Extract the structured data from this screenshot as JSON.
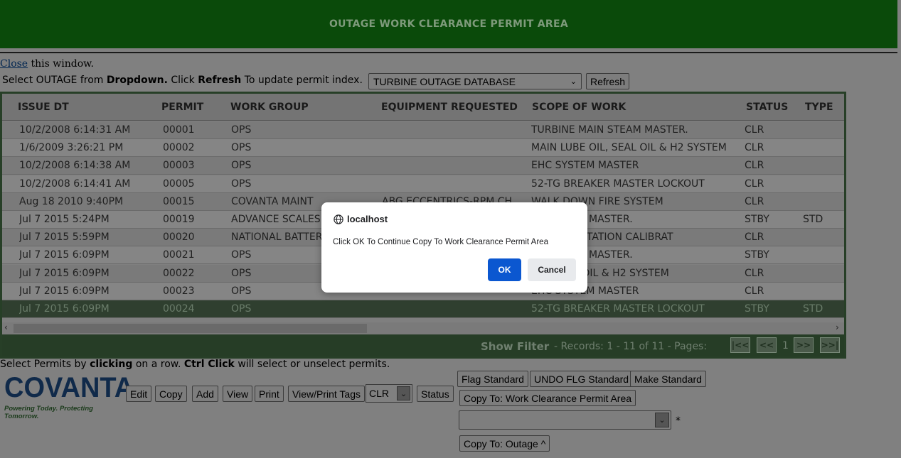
{
  "header": {
    "title": "OUTAGE WORK CLEARANCE PERMIT AREA"
  },
  "close_bar": {
    "link": "Close",
    "rest": " this window."
  },
  "select_bar": {
    "t1": "Select OUTAGE from ",
    "b1": "Dropdown.",
    "t2": " Click ",
    "b2": "Refresh",
    "t3": " To update permit index.",
    "outage_value": "TURBINE OUTAGE DATABASE",
    "refresh_label": "Refresh"
  },
  "table": {
    "columns": [
      "ISSUE DT",
      "PERMIT",
      "WORK GROUP",
      "EQUIPMENT REQUESTED",
      "SCOPE OF WORK",
      "STATUS",
      "TYPE"
    ],
    "rows": [
      {
        "issue_dt": "10/2/2008 6:14:31 AM",
        "permit": "00001",
        "work_group": "OPS",
        "equipment": "",
        "scope": "TURBINE MAIN STEAM MASTER.",
        "status": "CLR",
        "type": ""
      },
      {
        "issue_dt": "1/6/2009 3:26:21 PM",
        "permit": "00002",
        "work_group": "OPS",
        "equipment": "",
        "scope": "MAIN LUBE OIL, SEAL OIL & H2 SYSTEM",
        "status": "CLR",
        "type": ""
      },
      {
        "issue_dt": "10/2/2008 6:14:38 AM",
        "permit": "00003",
        "work_group": "OPS",
        "equipment": "",
        "scope": "EHC SYSTEM MASTER",
        "status": "CLR",
        "type": ""
      },
      {
        "issue_dt": "10/2/2008 6:14:41 AM",
        "permit": "00005",
        "work_group": "OPS",
        "equipment": "",
        "scope": "52-TG BREAKER MASTER LOCKOUT",
        "status": "CLR",
        "type": ""
      },
      {
        "issue_dt": "Aug 18 2010 9:40PM",
        "permit": "00015",
        "work_group": "COVANTA MAINT",
        "equipment": "ABG ECCENTRICS-RPM CH",
        "scope": "WALK DOWN FIRE SYSTEM",
        "status": "CLR",
        "type": ""
      },
      {
        "issue_dt": "Jul 7 2015 5:24PM",
        "permit": "00019",
        "work_group": "ADVANCE SCALES",
        "equipment": "",
        "scope": "AIN STEAM MASTER.",
        "status": "STBY",
        "type": "STD"
      },
      {
        "issue_dt": "Jul 7 2015 5:59PM",
        "permit": "00020",
        "work_group": "NATIONAL BATTERY",
        "equipment": "",
        "scope": "NSTERMENTATION CALIBRAT",
        "status": "CLR",
        "type": ""
      },
      {
        "issue_dt": "Jul 7 2015 6:09PM",
        "permit": "00021",
        "work_group": "OPS",
        "equipment": "",
        "scope": "AIN STEAM MASTER.",
        "status": "STBY",
        "type": ""
      },
      {
        "issue_dt": "Jul 7 2015 6:09PM",
        "permit": "00022",
        "work_group": "OPS",
        "equipment": "",
        "scope": "OIL, SEAL OIL & H2 SYSTEM",
        "status": "CLR",
        "type": ""
      },
      {
        "issue_dt": "Jul 7 2015 6:09PM",
        "permit": "00023",
        "work_group": "OPS",
        "equipment": "",
        "scope": "EHC SYSTEM MASTER",
        "status": "CLR",
        "type": ""
      },
      {
        "issue_dt": "Jul 7 2015 6:09PM",
        "permit": "00024",
        "work_group": "OPS",
        "equipment": "",
        "scope": "52-TG BREAKER MASTER LOCKOUT",
        "status": "STBY",
        "type": "STD"
      }
    ]
  },
  "pager": {
    "show_filter": "Show Filter",
    "records": "-   Records: 1 - 11 of 11 - Pages:",
    "page": "1",
    "first": "|<<",
    "prev": "<<",
    "next": ">>",
    "last": ">>|"
  },
  "hint": {
    "t1": "Select Permits by ",
    "b1": "clicking",
    "t2": " on a row. ",
    "b2": "Ctrl Click",
    "t3": " will select or unselect permits."
  },
  "logo": {
    "name": "COVANTA",
    "tagline": "Powering Today. Protecting Tomorrow."
  },
  "actions": {
    "edit": "Edit",
    "copy": "Copy",
    "add": "Add",
    "view": "View",
    "print": "Print",
    "view_print_tags": "View/Print Tags",
    "status_value": "CLR",
    "status_btn": "Status",
    "flag_standard": "Flag Standard",
    "undo_flg_standard": "UNDO FLG Standard",
    "make_standard": "Make Standard",
    "copy_to_wc": "Copy To: Work Clearance Permit Area",
    "wc_asterisk": "*",
    "copy_to_outage": "Copy To: Outage ^"
  },
  "dialog": {
    "title": "localhost",
    "message": "Click OK To Continue Copy To Work Clearance Permit Area",
    "ok": "OK",
    "cancel": "Cancel"
  },
  "colors": {
    "header_bg": "#0a4a0a",
    "dialog_ok": "#0b57d0",
    "grid_border": "#273f27"
  }
}
